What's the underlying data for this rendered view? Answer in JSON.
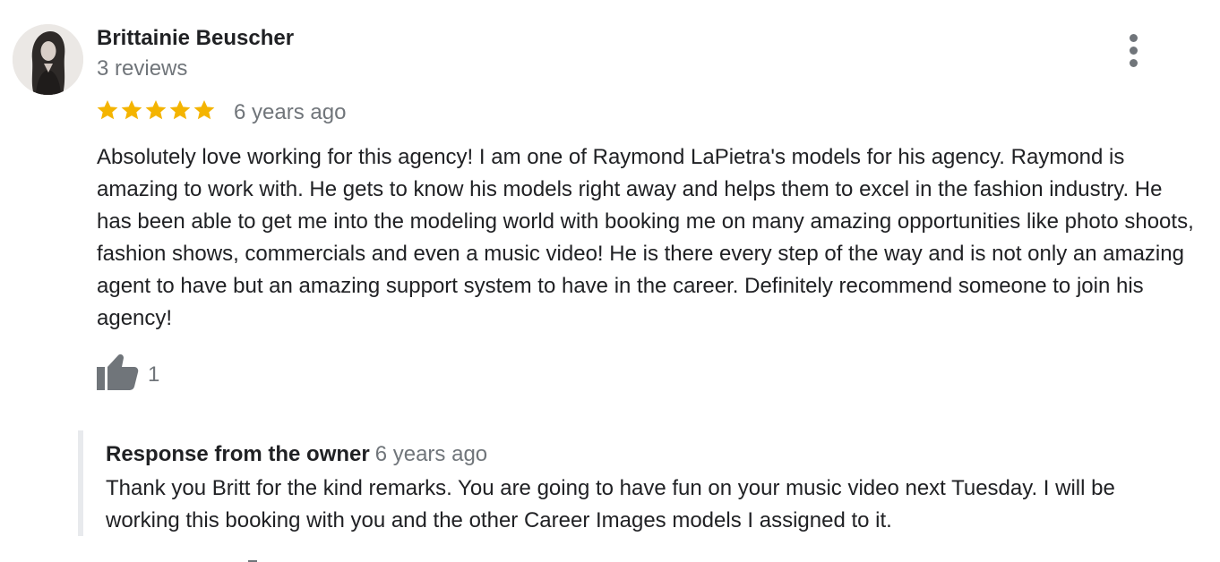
{
  "review": {
    "reviewer_name": "Brittainie Beuscher",
    "review_count": "3 reviews",
    "rating": 5,
    "max_rating": 5,
    "time_ago": "6 years ago",
    "text": "Absolutely love working for this agency! I am one of Raymond LaPietra's models for his agency. Raymond is amazing to work with. He gets to know his models right away and helps them to excel in the fashion industry. He has been able to get me into the modeling world with booking me on many amazing opportunities like photo shoots, fashion shows, commercials and even a music video! He is there every step of the way and is not only an amazing agent to have but an amazing support system to have in the career. Definitely recommend someone to join his agency!",
    "like_count": "1"
  },
  "owner_response": {
    "label": "Response from the owner",
    "time_ago": "6 years ago",
    "text": "Thank you Britt for the kind remarks. You are going to have fun on your music video next Tuesday. I will be working this booking with you and the other Career Images models I assigned to it."
  },
  "icons": {
    "avatar": "reviewer-photo",
    "menu": "more-vert-icon",
    "star": "star-icon",
    "like": "thumb-up-icon"
  },
  "colors": {
    "star": "#f4b400",
    "secondary_text": "#70757a",
    "primary_text": "#202124",
    "response_border": "#e8eaed"
  }
}
